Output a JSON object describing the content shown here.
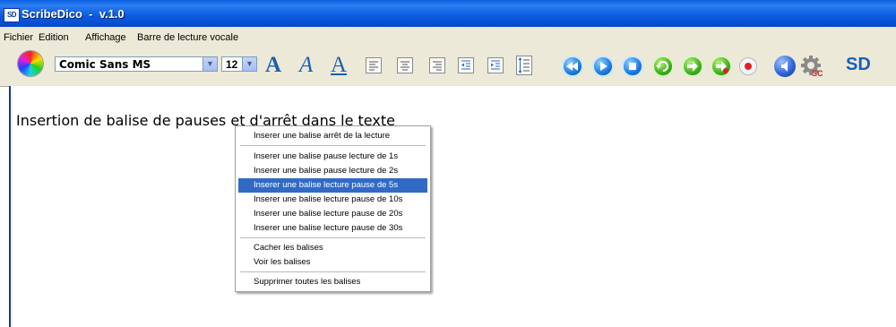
{
  "window": {
    "icon_text": "SD",
    "title": "ScribeDico  -  v.1.0"
  },
  "menu": [
    "Fichier",
    "Edition",
    "Affichage",
    "Barre de lecture vocale"
  ],
  "toolbar": {
    "font_value": "Comic Sans MS",
    "size_value": "12",
    "logo_text": "SD",
    "font_size_buttons": [
      "A",
      "A",
      "A"
    ],
    "icons": [
      "color-wheel-icon",
      "font-size-large-icon",
      "font-italic-icon",
      "font-underline-icon",
      "align-left-icon",
      "align-center-icon",
      "align-right-icon",
      "decrease-indent-icon",
      "increase-indent-icon",
      "line-spacing-icon",
      "rewind-icon",
      "play-icon",
      "stop-icon",
      "repeat-icon",
      "next-icon",
      "skip-icon",
      "record-icon",
      "sound-icon",
      "settings-icon"
    ]
  },
  "editor": {
    "text": "Insertion de balise de pauses et d'arrêt dans le texte"
  },
  "context_menu": {
    "groups": [
      [
        "Inserer une  balise arrêt  de la lecture"
      ],
      [
        "Inserer une balise pause lecture de 1s",
        "Inserer une balise pause lecture de 2s",
        "Inserer une balise  lecture pause de 5s",
        "Inserer une balise  lecture pause de 10s",
        "Inserer une balise  lecture pause de 20s",
        "Inserer une balise  lecture pause de 30s"
      ],
      [
        "Cacher les balises",
        "Voir les balises"
      ],
      [
        "Supprimer toutes les balises"
      ]
    ],
    "highlighted": "Inserer une balise  lecture pause de 5s"
  },
  "colors": {
    "title_bar": "#0a5ae0",
    "highlight": "#316ac5",
    "toolbar_icon_blue": "#1a7ae0",
    "toolbar_icon_green": "#3fae1d"
  }
}
